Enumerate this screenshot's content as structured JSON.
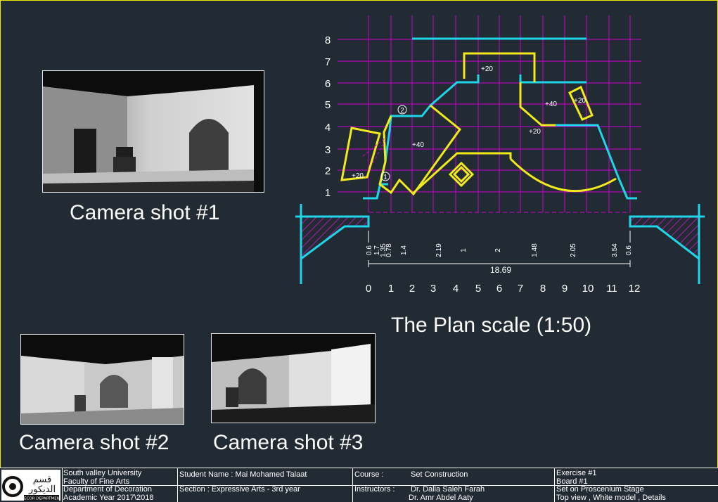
{
  "camera_shots": [
    {
      "caption": "Camera shot #1"
    },
    {
      "caption": "Camera shot #2"
    },
    {
      "caption": "Camera shot #3"
    }
  ],
  "plan": {
    "title": "The Plan scale (1:50)",
    "y_axis_labels": [
      "8",
      "7",
      "6",
      "5",
      "4",
      "3",
      "2",
      "1"
    ],
    "x_axis_labels": [
      "0",
      "1",
      "2",
      "3",
      "4",
      "5",
      "6",
      "7",
      "8",
      "9",
      "10",
      "11",
      "12"
    ],
    "dimensions": [
      "0.6",
      "1.7",
      "1.35",
      "0.78",
      "1.4",
      "2.19",
      "1",
      "2",
      "1.48",
      "2.05",
      "3.54",
      "0.6"
    ],
    "total_width": "18.69",
    "level_labels": [
      "+20",
      "+40",
      "+20",
      "+20",
      "+40",
      "+20"
    ],
    "markers": [
      "2",
      "1"
    ],
    "colors": {
      "grid": "#d000d0",
      "walls": "#f2ea1a",
      "stage": "#1fd6e8",
      "hatch": "#b01aa8"
    }
  },
  "title_block": {
    "university": "South valley University",
    "faculty": "Faculty of Fine Arts",
    "department": "Department of Decoration",
    "academic_year": "Academic Year 2017\\2018",
    "student": "Student Name : Mai Mohamed Talaat",
    "section": "Section : Expressive Arts - 3rd year",
    "course_label": "Course :",
    "course_value": "Set Construction",
    "instructors_label": "Instructors :",
    "instructor_1": "Dr. Dalia Saleh Farah",
    "instructor_2": "Dr. Amr Abdel Aaty",
    "exercise": "Exercise #1",
    "board": "Board #1",
    "subject": "Set on Proscenium Stage",
    "details": "Top view , White model , Details",
    "logo_arabic": "قسم الديكور",
    "logo_english": "DECOR DEPARTMENT"
  }
}
